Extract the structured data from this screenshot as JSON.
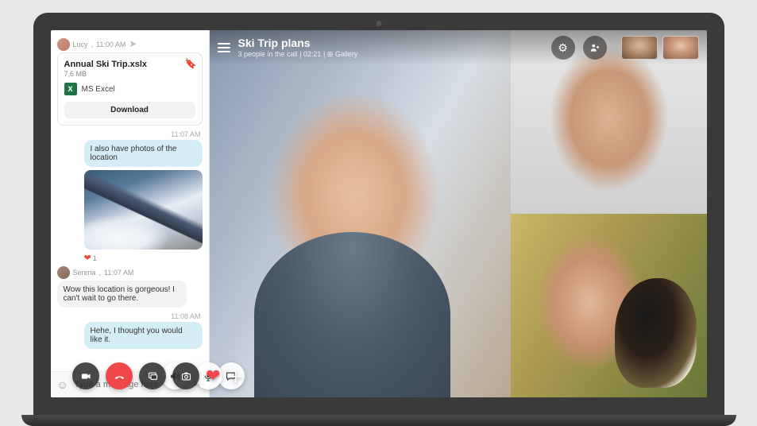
{
  "chat": {
    "sender1": {
      "name": "Lucy",
      "time": "11:00 AM"
    },
    "file": {
      "title": "Annual Ski Trip.xslx",
      "size": "7,6 MB",
      "type_label": "MS Excel",
      "download_label": "Download"
    },
    "time_1107": "11:07 AM",
    "msg_photos": "I also have photos of the location",
    "react_count": "1",
    "sender2": {
      "name": "Serena",
      "time": "11:07 AM"
    },
    "msg_wow": "Wow this location is gorgeous! I can't wait to go there.",
    "time_1108": "11:08 AM",
    "msg_hehe": "Hehe, I thought you would like it.",
    "compose_placeholder": "Type a message here"
  },
  "call": {
    "title": "Ski Trip plans",
    "sub_people": "3 people in the call",
    "duration": "02:21",
    "gallery_label": "Gallery"
  }
}
